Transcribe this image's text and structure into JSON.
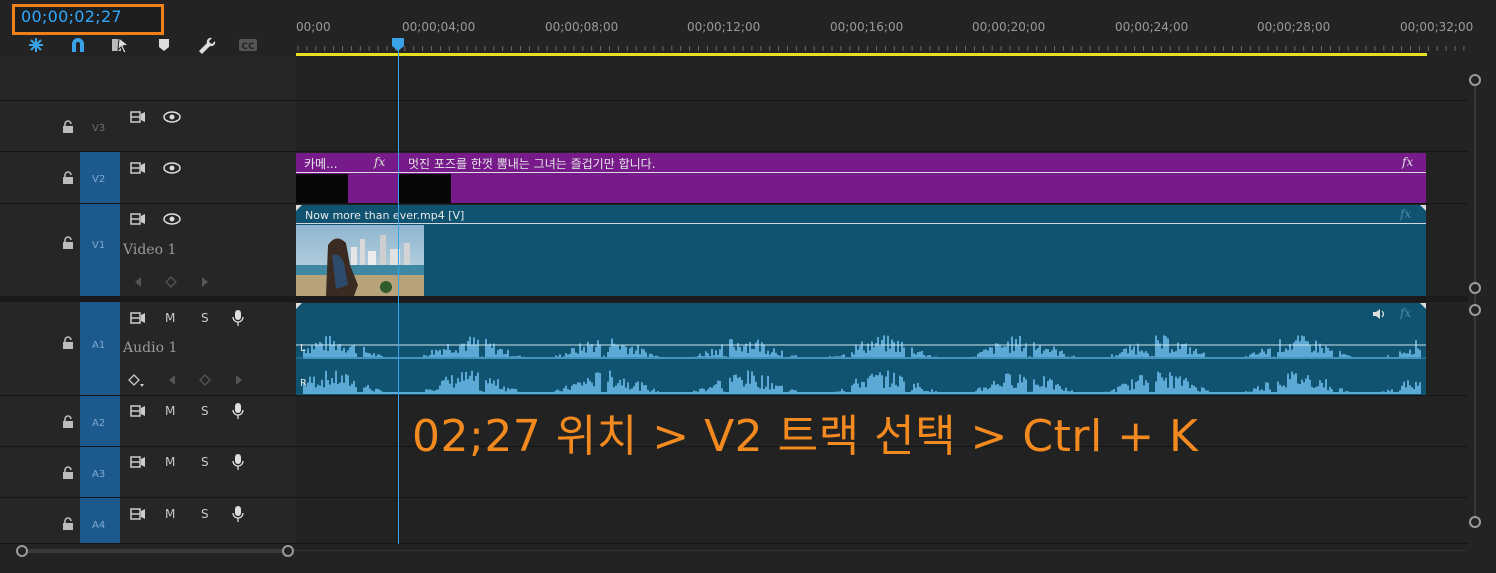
{
  "timecode": "00;00;02;27",
  "toolbar": {
    "icons": [
      "snap-insert-icon",
      "magnet-icon",
      "linked-selection-icon",
      "add-marker-icon",
      "wrench-icon",
      "captions-icon"
    ]
  },
  "ruler": {
    "labels": [
      "00;00",
      "00;00;04;00",
      "00;00;08;00",
      "00;00;12;00",
      "00;00;16;00",
      "00;00;20;00",
      "00;00;24;00",
      "00;00;28;00",
      "00;00;32;00"
    ]
  },
  "tracks": {
    "V3": {
      "label": "V3"
    },
    "V2": {
      "label": "V2"
    },
    "V1": {
      "label": "V1",
      "name": "Video 1"
    },
    "A1": {
      "label": "A1",
      "name": "Audio 1",
      "m": "M",
      "s": "S"
    },
    "A2": {
      "label": "A2",
      "m": "M",
      "s": "S"
    },
    "A3": {
      "label": "A3",
      "m": "M",
      "s": "S"
    },
    "A4": {
      "label": "A4",
      "m": "M",
      "s": "S"
    }
  },
  "clips": {
    "v2_clip_a": "카메...",
    "v2_clip_b": "멋진 포즈를 한껏 뽐내는 그녀는 즐겁기만 합니다.",
    "v1_clip": "Now more than ever.mp4 [V]",
    "fx": "fx",
    "audio_left": "L",
    "audio_right": "R"
  },
  "caption": "02;27 위치 > V2 트랙 선택 > Ctrl + K",
  "colors": {
    "accent": "#2ea9ff",
    "highlight": "#f0801a",
    "caption": "#f28a1f",
    "graphic_clip": "#771a8a",
    "video_clip": "#0f5370",
    "track_target": "#1c5a8e",
    "work_area": "#e6e020"
  }
}
